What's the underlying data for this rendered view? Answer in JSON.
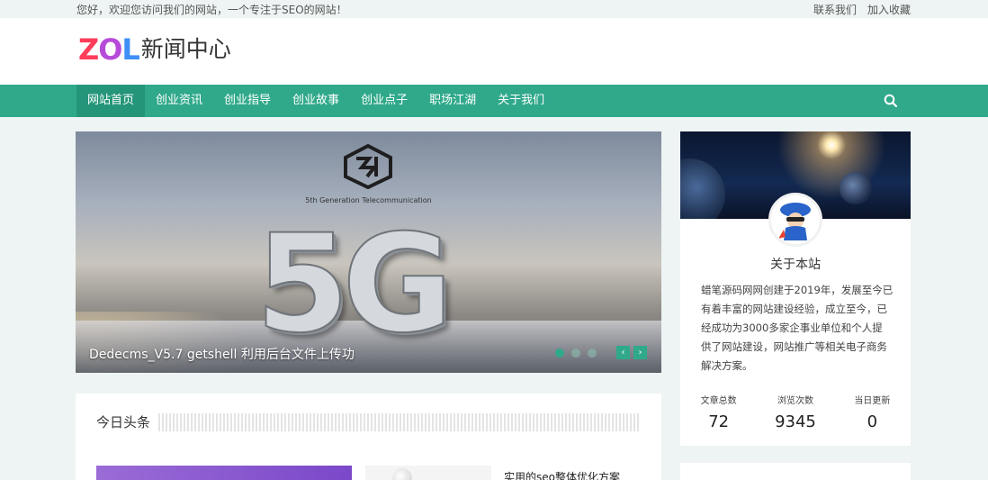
{
  "topbar": {
    "welcome": "您好，欢迎您访问我们的网站，一个专注于SEO的网站！",
    "contact": "联系我们",
    "favorite": "加入收藏"
  },
  "logo": {
    "zol_z": "Z",
    "zol_o": "O",
    "zol_l": "L",
    "text": "新闻中心"
  },
  "nav": {
    "items": [
      "网站首页",
      "创业资讯",
      "创业指导",
      "创业故事",
      "创业点子",
      "职场江湖",
      "关于我们"
    ],
    "active_index": 0
  },
  "slider": {
    "brand_text": "5th Generation Telecommunication",
    "hero_text": "5G",
    "caption": "Dedecms_V5.7 getshell 利用后台文件上传功",
    "prev": "‹",
    "next": "›",
    "active_dot": 0
  },
  "today": {
    "title": "今日头条",
    "article_title": "实用的seo整体优化方案"
  },
  "about": {
    "heading": "关于本站",
    "description": "蜡笔源码网网创建于2019年，发展至今已有着丰富的网站建设经验，成立至今，已经成功为3000多家企事业单位和个人提 供了网站建设，网站推广等相关电子商务解决方案。",
    "stats": [
      {
        "label": "文章总数",
        "value": "72"
      },
      {
        "label": "浏览次数",
        "value": "9345"
      },
      {
        "label": "当日更新",
        "value": "0"
      }
    ]
  },
  "colors": {
    "accent": "#30a98b",
    "background": "#eef4f3"
  }
}
